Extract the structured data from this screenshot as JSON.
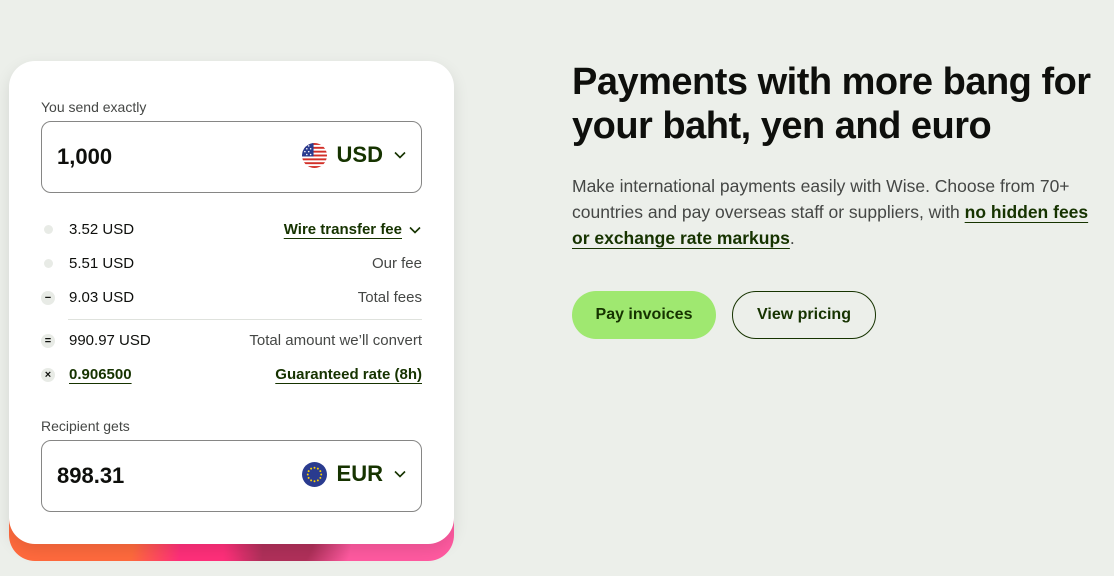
{
  "calculator": {
    "send_label": "You send exactly",
    "send_amount": "1,000",
    "send_currency": "USD",
    "send_flag_icon": "us-flag-icon",
    "fees": [
      {
        "symbol": "",
        "amount": "3.52 USD",
        "description": "Wire transfer fee"
      },
      {
        "symbol": "",
        "amount": "5.51 USD",
        "description": "Our fee"
      },
      {
        "symbol": "−",
        "amount": "9.03 USD",
        "description": "Total fees"
      }
    ],
    "convert": {
      "symbol": "=",
      "amount": "990.97 USD",
      "description": "Total amount we’ll convert"
    },
    "rate": {
      "symbol": "×",
      "amount": "0.906500",
      "description": "Guaranteed rate (8h)"
    },
    "receive_label": "Recipient gets",
    "receive_amount": "898.31",
    "receive_currency": "EUR",
    "receive_flag_icon": "eu-flag-icon"
  },
  "hero": {
    "headline": "Payments with more bang for your baht, yen and euro",
    "body_start": "Make international payments easily with Wise. Choose from 70+ countries and pay overseas staff or suppliers, with ",
    "body_link": "no hidden fees or exchange rate markups",
    "body_end": ".",
    "primary_button": "Pay invoices",
    "secondary_button": "View pricing"
  },
  "colors": {
    "background": "#ecefea",
    "accent_green": "#9fe870",
    "forest_green": "#163300"
  }
}
